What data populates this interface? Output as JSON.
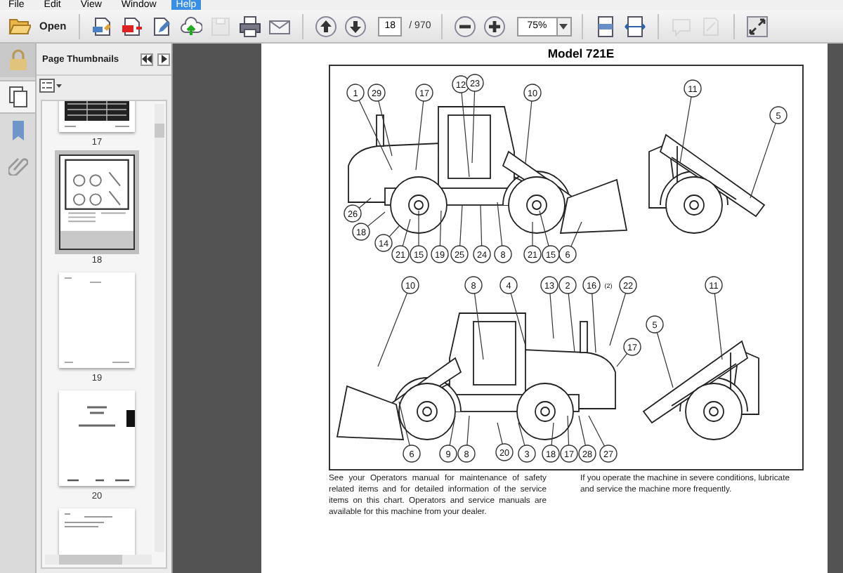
{
  "menu_bar": [
    {
      "label": "File",
      "selected": false
    },
    {
      "label": "Edit",
      "selected": false
    },
    {
      "label": "View",
      "selected": false
    },
    {
      "label": "Window",
      "selected": false
    },
    {
      "label": "Help",
      "selected": true
    }
  ],
  "toolbar": {
    "open": {
      "label": "Open"
    },
    "page": {
      "value": "18",
      "count": "/ 970"
    },
    "zoom": {
      "value": "75%"
    },
    "groups": [
      {
        "items": [
          {
            "kind": "create",
            "disabled": false
          },
          {
            "kind": "export",
            "disabled": false
          },
          {
            "kind": "edit",
            "disabled": false
          },
          {
            "kind": "upload",
            "disabled": false
          },
          {
            "kind": "save",
            "disabled": true
          },
          {
            "kind": "print",
            "disabled": false
          },
          {
            "kind": "email",
            "disabled": false
          }
        ]
      },
      {
        "kind": "page-nav",
        "items": [
          {
            "kind": "prev",
            "disabled": false
          },
          {
            "kind": "next",
            "disabled": false
          }
        ]
      },
      {
        "kind": "zoom",
        "items": [
          {
            "kind": "zoom-out",
            "disabled": false
          },
          {
            "kind": "zoom-in",
            "disabled": false
          }
        ]
      },
      {
        "items": [
          {
            "kind": "fit-page",
            "disabled": false
          },
          {
            "kind": "fit-width",
            "disabled": false
          }
        ]
      },
      {
        "items": [
          {
            "kind": "comment",
            "disabled": true
          },
          {
            "kind": "sign",
            "disabled": true
          }
        ]
      },
      {
        "items": [
          {
            "kind": "fullscreen",
            "disabled": false
          }
        ]
      }
    ]
  },
  "nav_tabs": [
    {
      "kind": "pages",
      "selected": true
    },
    {
      "kind": "bookmarks",
      "selected": false
    },
    {
      "kind": "attachments",
      "selected": false
    }
  ],
  "panel": {
    "title": "Page Thumbnails",
    "thumbnails": [
      {
        "kind": "table",
        "label": "17",
        "selected": false
      },
      {
        "kind": "diagram",
        "label": "18",
        "selected": true
      },
      {
        "kind": "blank",
        "label": "19",
        "selected": false
      },
      {
        "kind": "cover",
        "label": "20",
        "selected": false
      },
      {
        "kind": "list",
        "selected": false
      }
    ]
  },
  "page": {
    "title": "Model 721E",
    "callouts": [
      {
        "text": "1",
        "kind": "circle"
      },
      {
        "text": "29",
        "kind": "circle"
      },
      {
        "text": "17",
        "kind": "circle"
      },
      {
        "text": "12",
        "kind": "circle"
      },
      {
        "text": "23",
        "kind": "circle"
      },
      {
        "text": "10",
        "kind": "circle"
      },
      {
        "text": "11",
        "kind": "circle"
      },
      {
        "text": "5",
        "kind": "circle"
      },
      {
        "text": "26",
        "kind": "circle"
      },
      {
        "text": "18",
        "kind": "circle"
      },
      {
        "text": "14",
        "kind": "circle"
      },
      {
        "text": "21",
        "kind": "circle"
      },
      {
        "text": "15",
        "kind": "circle"
      },
      {
        "text": "19",
        "kind": "circle"
      },
      {
        "text": "25",
        "kind": "circle"
      },
      {
        "text": "24",
        "kind": "circle"
      },
      {
        "text": "8",
        "kind": "circle"
      },
      {
        "text": "21",
        "kind": "circle"
      },
      {
        "text": "15",
        "kind": "circle"
      },
      {
        "text": "6",
        "kind": "circle"
      },
      {
        "text": "10",
        "kind": "circle"
      },
      {
        "text": "8",
        "kind": "circle"
      },
      {
        "text": "4",
        "kind": "circle"
      },
      {
        "text": "13",
        "kind": "circle"
      },
      {
        "text": "2",
        "kind": "circle"
      },
      {
        "text": "16",
        "kind": "circle"
      },
      {
        "text": "(2)",
        "kind": "note"
      },
      {
        "text": "22",
        "kind": "circle"
      },
      {
        "text": "5",
        "kind": "circle"
      },
      {
        "text": "11",
        "kind": "circle"
      },
      {
        "text": "17",
        "kind": "circle"
      },
      {
        "text": "6",
        "kind": "circle"
      },
      {
        "text": "9",
        "kind": "circle"
      },
      {
        "text": "8",
        "kind": "circle"
      },
      {
        "text": "20",
        "kind": "circle"
      },
      {
        "text": "3",
        "kind": "circle"
      },
      {
        "text": "18",
        "kind": "circle"
      },
      {
        "text": "17",
        "kind": "circle"
      },
      {
        "text": "28",
        "kind": "circle"
      },
      {
        "text": "27",
        "kind": "circle"
      }
    ],
    "paragraphs": [
      "See your Operators manual for maintenance of safety related items and for detailed information of the service items on this chart. Operators and service manuals are available for this machine from your dealer.",
      "If you operate the machine in severe conditions, lubricate and service the machine more frequently."
    ]
  }
}
